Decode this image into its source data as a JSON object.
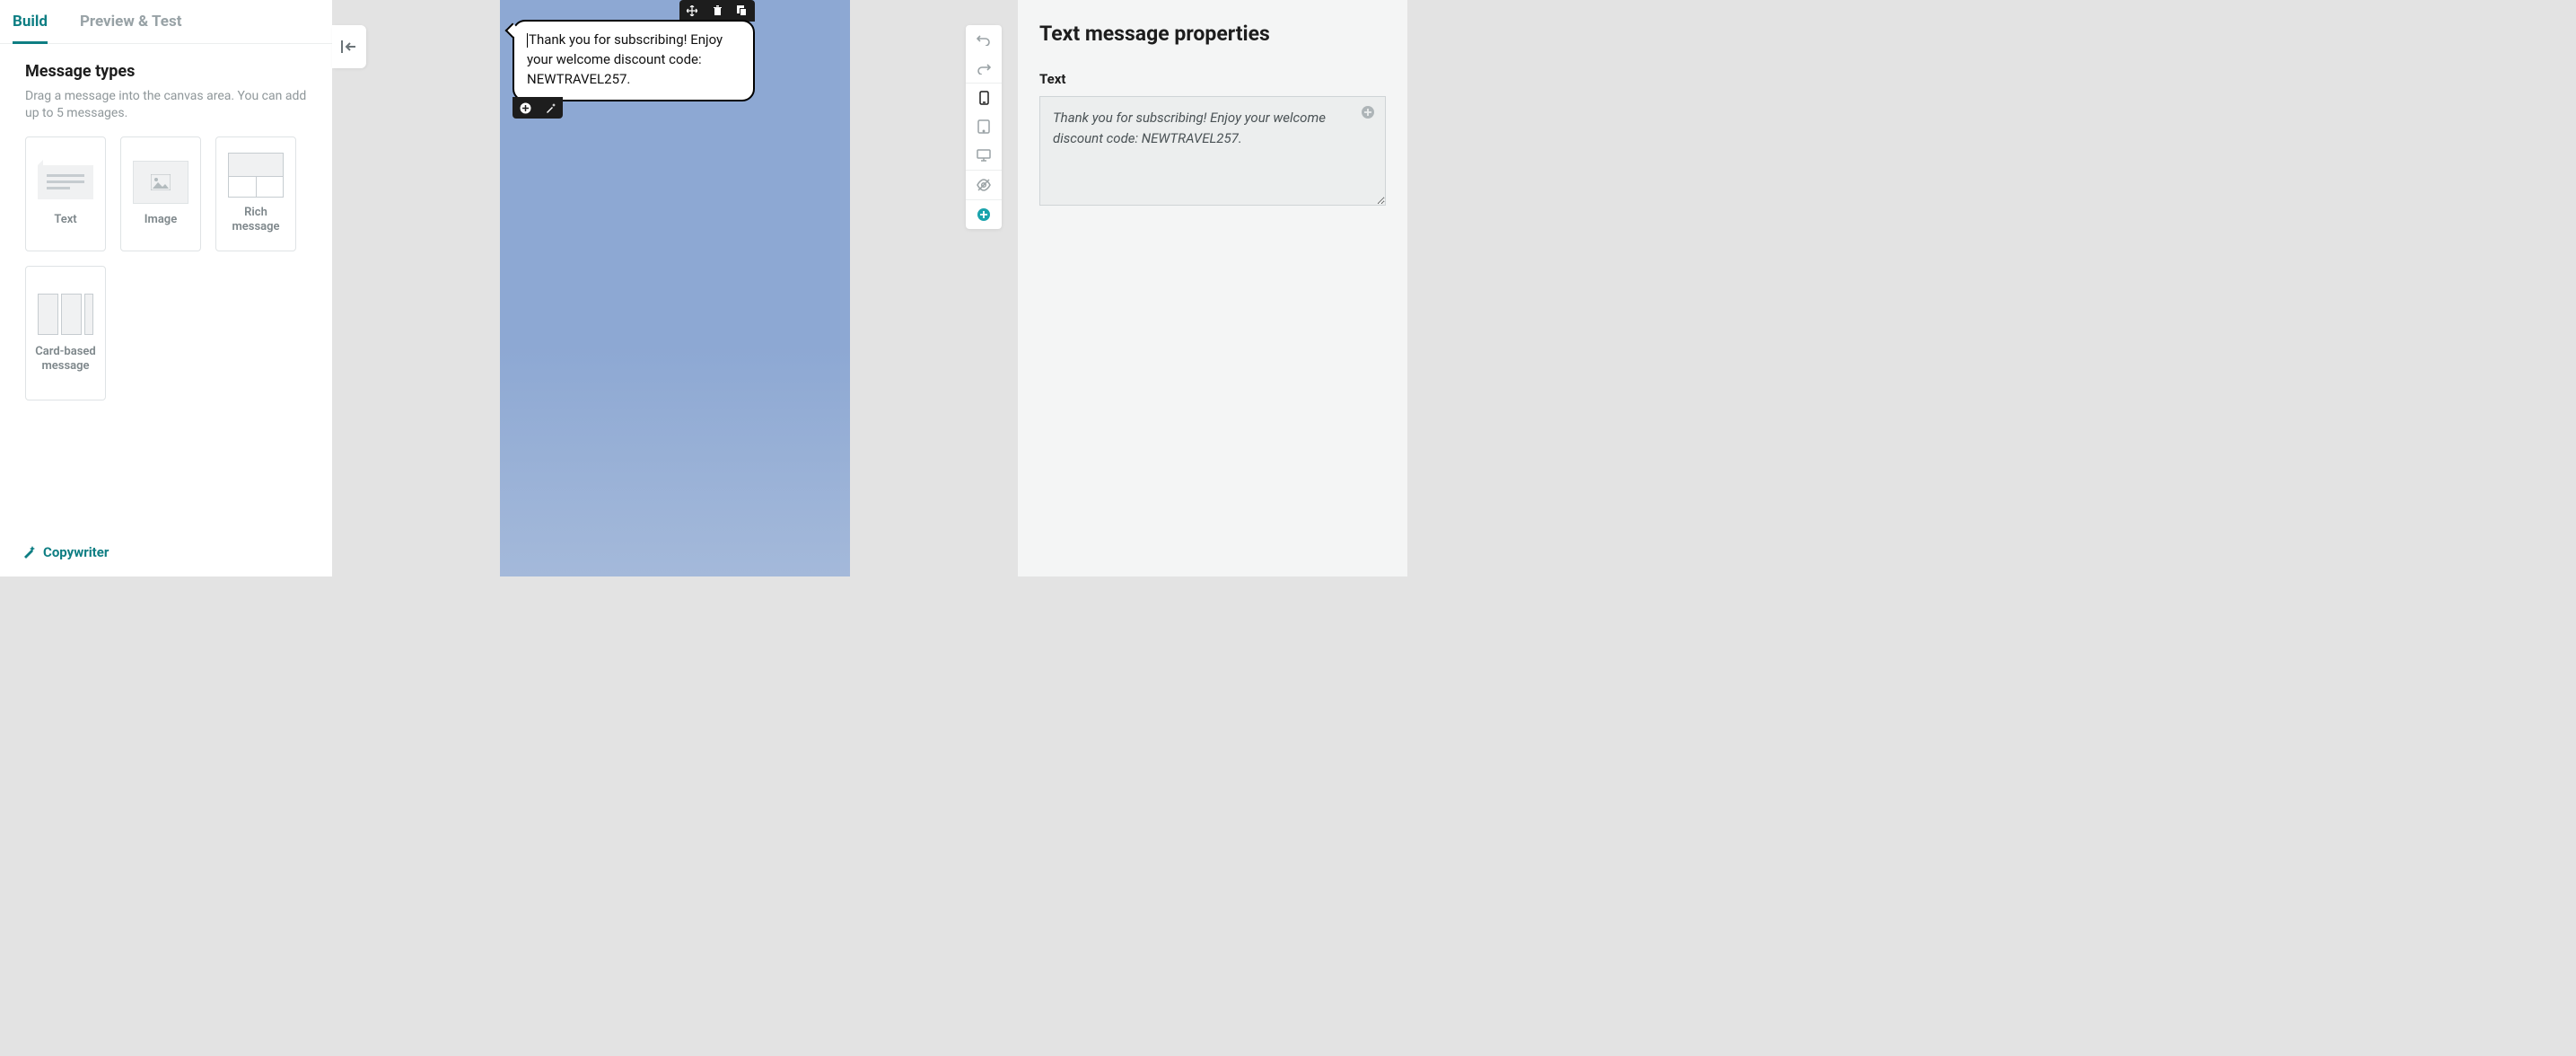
{
  "tabs": {
    "build": "Build",
    "preview": "Preview & Test"
  },
  "sidebar": {
    "section_title": "Message types",
    "section_desc": "Drag a message into the canvas area. You can add up to 5 messages.",
    "tiles": {
      "text": "Text",
      "image": "Image",
      "rich": "Rich message",
      "cards": "Card-based message"
    },
    "copywriter": "Copywriter"
  },
  "canvas": {
    "bubble_text": "Thank you for subscribing! Enjoy your welcome discount code: NEWTRAVEL257."
  },
  "right": {
    "title": "Text message properties",
    "text_label": "Text",
    "textarea_value": "Thank you for subscribing! Enjoy your welcome discount code: NEWTRAVEL257."
  }
}
